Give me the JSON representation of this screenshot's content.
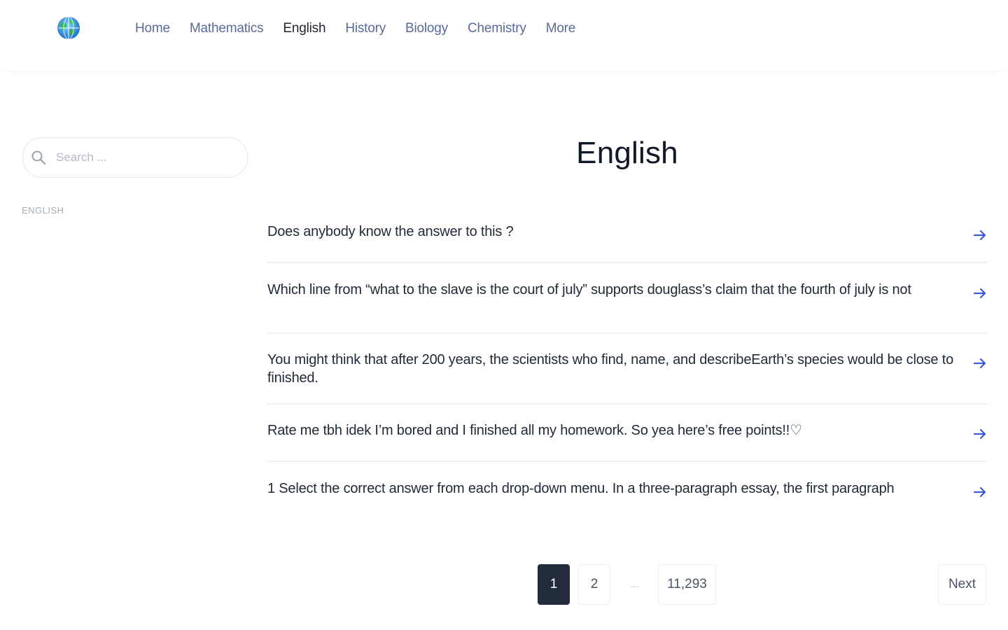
{
  "header": {
    "logo_icon": "globe-icon",
    "nav": [
      {
        "label": "Home",
        "active": false
      },
      {
        "label": "Mathematics",
        "active": false
      },
      {
        "label": "English",
        "active": true
      },
      {
        "label": "History",
        "active": false
      },
      {
        "label": "Biology",
        "active": false
      },
      {
        "label": "Chemistry",
        "active": false
      },
      {
        "label": "More",
        "active": false
      }
    ]
  },
  "sidebar": {
    "search": {
      "placeholder": "Search ...",
      "value": "",
      "icon": "search-icon"
    },
    "category_label": "ENGLISH"
  },
  "main": {
    "title": "English",
    "questions": [
      {
        "text": "Does anybody know the answer to this ?"
      },
      {
        "text": "Which line from “what to the slave is the court of july” supports douglass’s claim that the fourth of july is not"
      },
      {
        "text": "You might think that after 200 years, the scientists who find, name, and describeEarth’s species would be close to finished."
      },
      {
        "text": "Rate me tbh idek I’m bored and I finished all my homework. So yea here’s free points!!♡"
      },
      {
        "text": "1 Select the correct answer from each drop-down menu. In a three-paragraph essay, the first paragraph"
      }
    ],
    "arrow_icon": "arrow-right-icon"
  },
  "pagination": {
    "current": "1",
    "next_page": "2",
    "ellipsis": "...",
    "last_page": "11,293",
    "next_label": "Next"
  },
  "colors": {
    "accent_arrow": "#3b5bdb",
    "nav_link": "#5a6b9a",
    "active_page_bg": "#232c3d"
  }
}
